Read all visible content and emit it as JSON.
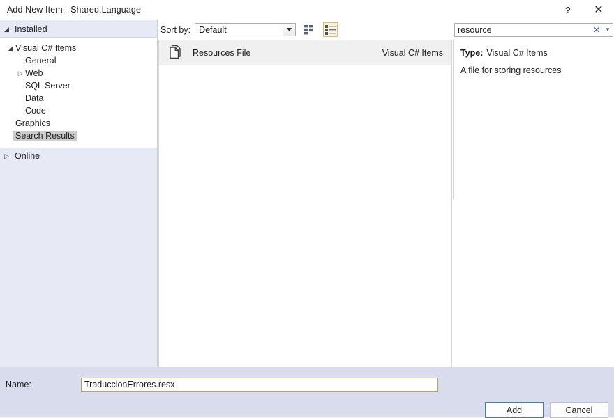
{
  "window": {
    "title": "Add New Item - Shared.Language",
    "help_label": "?",
    "close_label": "✕"
  },
  "sidebar": {
    "installed": {
      "label": "Installed",
      "expander": "◢",
      "tree": [
        {
          "label": "Visual C# Items",
          "indent": 0,
          "twisty": "◢",
          "selected": false
        },
        {
          "label": "General",
          "indent": 2,
          "twisty": "",
          "selected": false
        },
        {
          "label": "Web",
          "indent": 1,
          "twisty": "▷",
          "selected": false
        },
        {
          "label": "SQL Server",
          "indent": 2,
          "twisty": "",
          "selected": false
        },
        {
          "label": "Data",
          "indent": 2,
          "twisty": "",
          "selected": false
        },
        {
          "label": "Code",
          "indent": 2,
          "twisty": "",
          "selected": false
        },
        {
          "label": "Graphics",
          "indent": 1,
          "twisty": "",
          "selected": false
        },
        {
          "label": "Search Results",
          "indent": 1,
          "twisty": "",
          "selected": true
        }
      ]
    },
    "online": {
      "label": "Online",
      "expander": "▷"
    }
  },
  "toolbar": {
    "sort_by_label": "Sort by:",
    "sort_by_value": "Default",
    "sort_by_options": [
      "Default"
    ],
    "view_medium_icons_name": "medium-icons-view",
    "view_list_name": "list-view",
    "selected_view": "list-view"
  },
  "search": {
    "value": "resource",
    "placeholder": "Search (Ctrl+E)",
    "clear_label": "✕",
    "dropdown_label": "▾"
  },
  "results": {
    "items": [
      {
        "title": "Resources File",
        "origin": "Visual C# Items",
        "icon": "resources-file-icon",
        "selected": true
      }
    ]
  },
  "details": {
    "type_label": "Type:",
    "type_value": "Visual C# Items",
    "description": "A file for storing resources"
  },
  "bottom": {
    "name_label": "Name:",
    "name_value": "TraduccionErrores.resx",
    "name_placeholder": "Name"
  },
  "footer": {
    "add_label": "Add",
    "cancel_label": "Cancel"
  },
  "colors": {
    "dialog_background": "#ffffff",
    "panel_background": "#e7eaf4",
    "bottom_bar": "#d9dced",
    "selection_gray": "#cdcdcd",
    "row_selected": "#f0f0f0",
    "accent_focus": "#c0a062",
    "toggle_selected_border": "#e3b96b",
    "toggle_selected_fill": "#fdf4d9",
    "default_button_border": "#3c7fb1",
    "clear_icon": "#3b5bb5"
  }
}
